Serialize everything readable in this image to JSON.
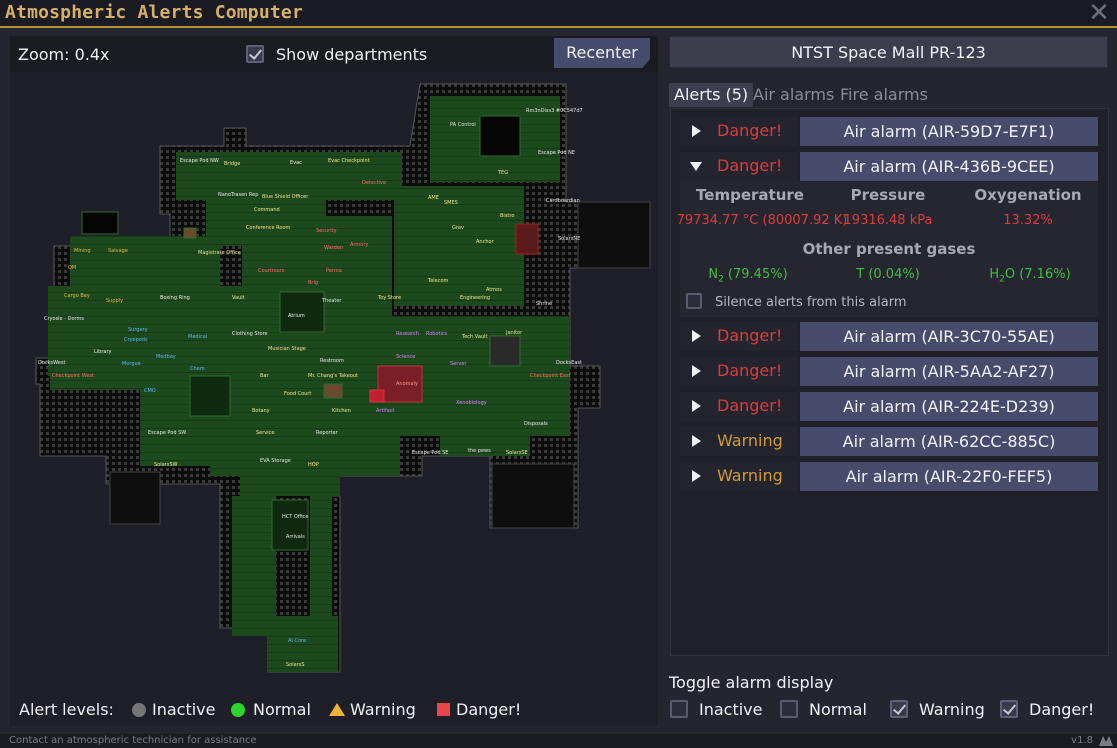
{
  "window": {
    "title": "Atmospheric Alerts Computer"
  },
  "map_panel": {
    "zoom_label": "Zoom: 0.4x",
    "show_departments_label": "Show departments",
    "show_departments_checked": true,
    "recenter_label": "Recenter",
    "map_labels": [
      "Escape Pod NW",
      "Bridge",
      "Evac",
      "Evac Checkpoint",
      "Rm3nDiss3 #0C547d7",
      "PA Control",
      "Escape Pod NE",
      "NanoTrasen Rep",
      "Blue Shield Officer",
      "Detective",
      "TEG",
      "Command",
      "Cardboardian",
      "AME",
      "SMES",
      "Bistro",
      "Conference Room",
      "Security",
      "Grav",
      "Anchor",
      "SolarsNE",
      "Mining",
      "Salvage",
      "Magistrate Office",
      "Warden",
      "Armory",
      "QM",
      "Courtroom",
      "Perma",
      "Telecom",
      "Cargo Bay",
      "Supply",
      "Vault",
      "Brig",
      "Atmos",
      "Boxing Ring",
      "Engineering",
      "Theater",
      "Toy Store",
      "Shrine",
      "Cryosle - Dorms",
      "Atrium",
      "Clothing Store",
      "Tech Vault",
      "Janitor",
      "Surgery",
      "Cryopods",
      "Medical",
      "Research",
      "Robotics",
      "Library",
      "Musician Stage",
      "Science",
      "DocksWest",
      "Medbay",
      "Restroom",
      "Server",
      "DocksEast",
      "Morgue",
      "Chem",
      "Checkpoint West",
      "Anomaly",
      "Checkpoint East",
      "Bar",
      "Mr. Chang's Takeout",
      "CMO",
      "Food Court",
      "Artifact",
      "Xenobiology",
      "Botany",
      "Kitchen",
      "Disposals",
      "Escape Pod SW",
      "Service",
      "Reporter",
      "Escape Pod SE",
      "the pews",
      "SolarsSE",
      "SolarsSW",
      "EVA Storage",
      "HOP",
      "HCT Office",
      "Arrivals",
      "AI Core",
      "SolarsS"
    ]
  },
  "legend": {
    "title": "Alert levels:",
    "items": [
      {
        "label": "Inactive",
        "color": "#757575",
        "shape": "circle"
      },
      {
        "label": "Normal",
        "color": "#2dd62d",
        "shape": "circle"
      },
      {
        "label": "Warning",
        "color": "#f0b33a",
        "shape": "triangle"
      },
      {
        "label": "Danger!",
        "color": "#e84848",
        "shape": "square"
      }
    ]
  },
  "station": {
    "name": "NTST Space Mall PR-123"
  },
  "tabs": [
    {
      "label": "Alerts (5)",
      "active": true
    },
    {
      "label": "Air alarms",
      "active": false
    },
    {
      "label": "Fire alarms",
      "active": false
    }
  ],
  "alerts": [
    {
      "level": "Danger!",
      "name": "Air alarm (AIR-59D7-E7F1)",
      "expanded": false
    },
    {
      "level": "Danger!",
      "name": "Air alarm (AIR-436B-9CEE)",
      "expanded": true
    },
    {
      "level": "Danger!",
      "name": "Air alarm (AIR-3C70-55AE)",
      "expanded": false
    },
    {
      "level": "Danger!",
      "name": "Air alarm (AIR-5AA2-AF27)",
      "expanded": false
    },
    {
      "level": "Danger!",
      "name": "Air alarm (AIR-224E-D239)",
      "expanded": false
    },
    {
      "level": "Warning",
      "name": "Air alarm (AIR-62CC-885C)",
      "expanded": false
    },
    {
      "level": "Warning",
      "name": "Air alarm (AIR-22F0-FEF5)",
      "expanded": false
    }
  ],
  "alert_detail": {
    "headers": {
      "temperature": "Temperature",
      "pressure": "Pressure",
      "oxygenation": "Oxygenation"
    },
    "values": {
      "temperature": "79734.77 °C (80007.92 K)",
      "pressure": "19316.48 kPa",
      "oxygenation": "13.32%"
    },
    "gases_header": "Other present gases",
    "gases": [
      {
        "symbol": "N",
        "sub": "2",
        "value": " (79.45%)"
      },
      {
        "symbol": "T",
        "sub": "",
        "value": " (0.04%)"
      },
      {
        "symbol": "H",
        "sub": "2",
        "symbol2": "O",
        "value": " (7.16%)"
      }
    ],
    "silence_label": "Silence alerts from this alarm",
    "silence_checked": false
  },
  "toggle_display": {
    "title": "Toggle alarm display",
    "options": [
      {
        "label": "Inactive",
        "checked": false
      },
      {
        "label": "Normal",
        "checked": false
      },
      {
        "label": "Warning",
        "checked": true
      },
      {
        "label": "Danger!",
        "checked": true
      }
    ]
  },
  "footer": {
    "text": "Contact an atmospheric technician for assistance",
    "version": "v1.8"
  },
  "colors": {
    "accent": "#b8913a",
    "danger": "#dc3c3c",
    "warning": "#cf9a3e",
    "normal": "#3fbf3f",
    "button": "#474c6c"
  }
}
